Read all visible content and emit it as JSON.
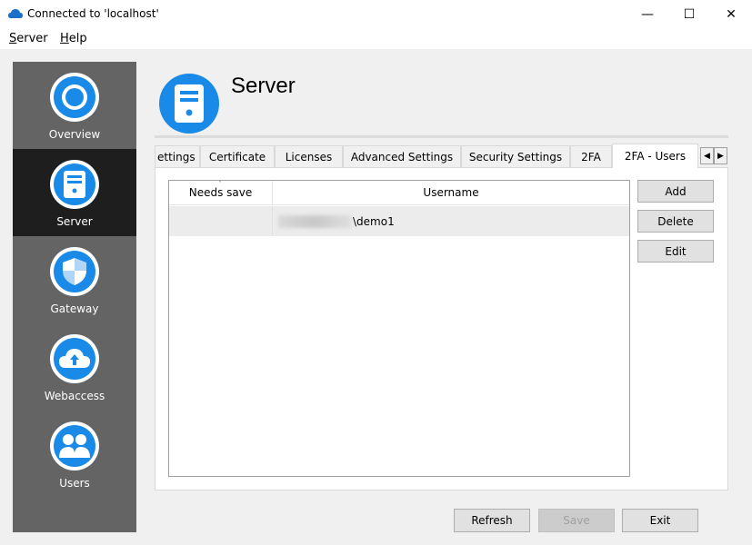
{
  "window": {
    "title": "Connected to 'localhost'",
    "minimize_glyph": "—",
    "maximize_glyph": "☐",
    "close_glyph": "✕"
  },
  "menu": {
    "server_ul": "S",
    "server_rest": "erver",
    "help_ul": "H",
    "help_rest": "elp"
  },
  "sidebar": {
    "items": [
      {
        "label": "Overview",
        "icon": "overview-icon",
        "active": false
      },
      {
        "label": "Server",
        "icon": "server-icon",
        "active": true
      },
      {
        "label": "Gateway",
        "icon": "shield-icon",
        "active": false
      },
      {
        "label": "Webaccess",
        "icon": "cloud-icon",
        "active": false
      },
      {
        "label": "Users",
        "icon": "users-icon",
        "active": false
      }
    ]
  },
  "header": {
    "title": "Server",
    "icon": "server-icon"
  },
  "tabs": [
    {
      "label": "ettings"
    },
    {
      "label": "Certificate"
    },
    {
      "label": "Licenses"
    },
    {
      "label": "Advanced Settings"
    },
    {
      "label": "Security Settings"
    },
    {
      "label": "2FA"
    },
    {
      "label": "2FA - Users",
      "active": true
    }
  ],
  "tab_scroll": {
    "left_glyph": "◀",
    "right_glyph": "▶"
  },
  "users_table": {
    "columns": [
      "Needs save",
      "Username"
    ],
    "rows": [
      {
        "needs_save": "",
        "username_suffix": "\\demo1"
      }
    ]
  },
  "side_buttons": {
    "add": "Add",
    "delete": "Delete",
    "edit": "Edit"
  },
  "bottom_buttons": {
    "refresh": "Refresh",
    "save": "Save",
    "exit": "Exit"
  },
  "colors": {
    "accent": "#1a8ae8",
    "sidebar_bg": "#646464",
    "sidebar_active": "#1e1e1e"
  }
}
